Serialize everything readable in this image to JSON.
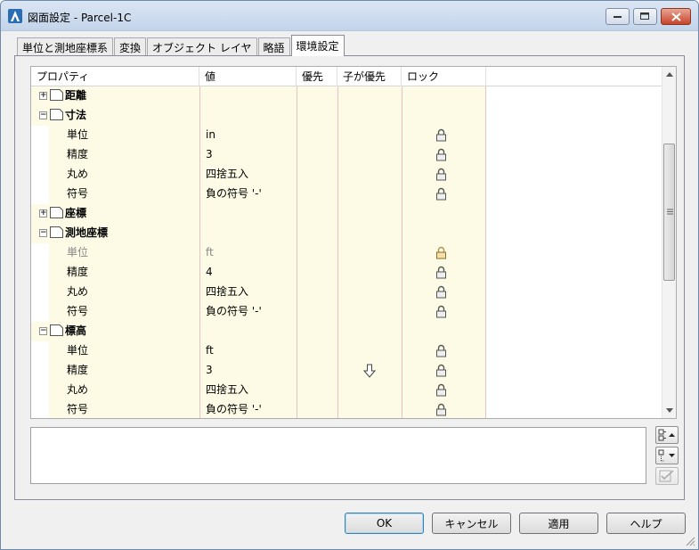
{
  "window": {
    "title": "図面設定 - Parcel-1C"
  },
  "tabs": [
    {
      "label": "単位と測地座標系"
    },
    {
      "label": "変換"
    },
    {
      "label": "オブジェクト レイヤ"
    },
    {
      "label": "略語"
    },
    {
      "label": "環境設定",
      "active": true
    }
  ],
  "grid": {
    "columns": [
      "プロパティ",
      "値",
      "優先",
      "子が優先",
      "ロック"
    ],
    "rows": [
      {
        "type": "category",
        "label": "距離",
        "expanded": false
      },
      {
        "type": "category",
        "label": "寸法",
        "expanded": true
      },
      {
        "type": "property",
        "name": "単位",
        "value": "in",
        "lock": "locked-icon"
      },
      {
        "type": "property",
        "name": "精度",
        "value": "3",
        "lock": "locked-icon"
      },
      {
        "type": "property",
        "name": "丸め",
        "value": "四捨五入",
        "lock": "locked-icon"
      },
      {
        "type": "property",
        "name": "符号",
        "value": "負の符号 '-'",
        "lock": "locked-icon"
      },
      {
        "type": "category",
        "label": "座標",
        "expanded": false
      },
      {
        "type": "category",
        "label": "測地座標",
        "expanded": true
      },
      {
        "type": "property",
        "name": "単位",
        "value": "ft",
        "lock": "locked-icon",
        "disabled": true
      },
      {
        "type": "property",
        "name": "精度",
        "value": "4",
        "lock": "locked-icon"
      },
      {
        "type": "property",
        "name": "丸め",
        "value": "四捨五入",
        "lock": "locked-icon"
      },
      {
        "type": "property",
        "name": "符号",
        "value": "負の符号 '-'",
        "lock": "locked-icon"
      },
      {
        "type": "category",
        "label": "標高",
        "expanded": true
      },
      {
        "type": "property",
        "name": "単位",
        "value": "ft",
        "lock": "locked-icon"
      },
      {
        "type": "property",
        "name": "精度",
        "value": "3",
        "lock": "locked-icon",
        "child_override": "down-arrow-icon"
      },
      {
        "type": "property",
        "name": "丸め",
        "value": "四捨五入",
        "lock": "locked-icon"
      },
      {
        "type": "property",
        "name": "符号",
        "value": "負の符号 '-'",
        "lock": "locked-icon"
      }
    ]
  },
  "buttons": {
    "ok": "OK",
    "cancel": "キャンセル",
    "apply": "適用",
    "help": "ヘルプ"
  },
  "colors": {
    "row_bg": "#fdfbe5",
    "grid_line": "#e8c8cc",
    "default_border": "#3c7fb1"
  }
}
